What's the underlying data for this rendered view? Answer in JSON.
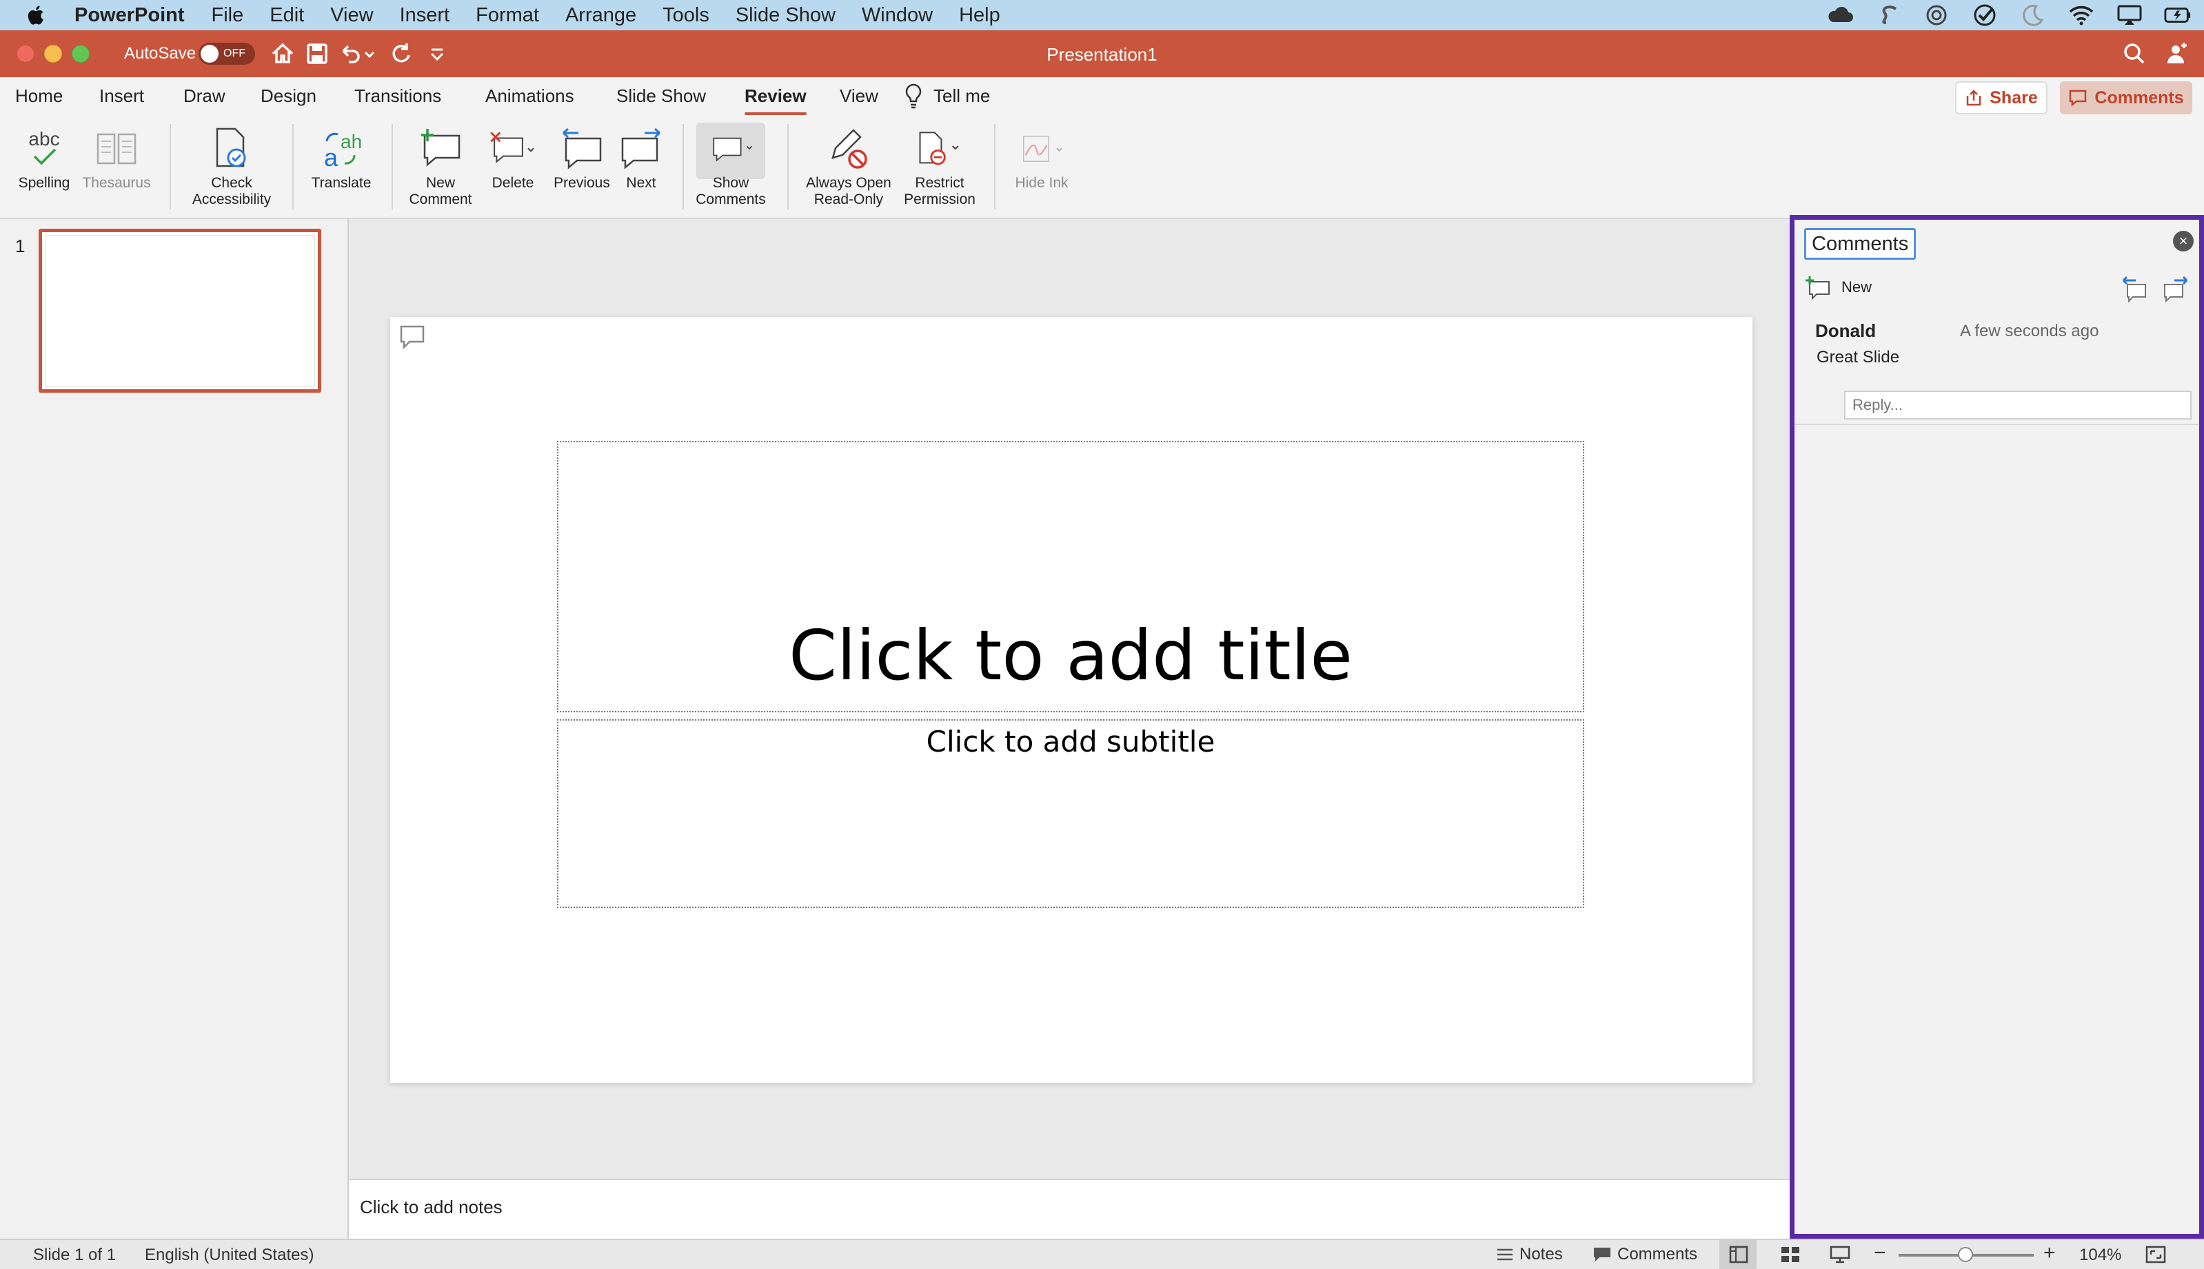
{
  "menubar": {
    "app_name": "PowerPoint",
    "items": [
      "File",
      "Edit",
      "View",
      "Insert",
      "Format",
      "Arrange",
      "Tools",
      "Slide Show",
      "Window",
      "Help"
    ],
    "tray_icons": [
      "cloud-icon",
      "s-app-icon",
      "sync-icon",
      "check-circle-icon",
      "moon-icon",
      "wifi-icon",
      "airplay-icon",
      "battery-icon"
    ]
  },
  "titlebar": {
    "autosave_label": "AutoSave",
    "autosave_state": "OFF",
    "document_title": "Presentation1"
  },
  "tabs": {
    "items": [
      "Home",
      "Insert",
      "Draw",
      "Design",
      "Transitions",
      "Animations",
      "Slide Show",
      "Review",
      "View"
    ],
    "active": "Review",
    "tell_me": "Tell me",
    "share": "Share",
    "comments": "Comments"
  },
  "ribbon": {
    "spelling_label": "Spelling",
    "spelling_glyph": "abc",
    "thesaurus": "Thesaurus",
    "check_accessibility": [
      "Check",
      "Accessibility"
    ],
    "translate": "Translate",
    "new_comment": [
      "New",
      "Comment"
    ],
    "delete": "Delete",
    "previous": "Previous",
    "next": "Next",
    "show_comments": [
      "Show",
      "Comments"
    ],
    "always_open": [
      "Always Open",
      "Read-Only"
    ],
    "restrict": [
      "Restrict",
      "Permission"
    ],
    "hide_ink": "Hide Ink"
  },
  "thumbnails": {
    "slide_number": "1"
  },
  "slide": {
    "title_placeholder": "Click to add title",
    "subtitle_placeholder": "Click to add subtitle"
  },
  "notes": {
    "placeholder": "Click to add notes"
  },
  "comments_pane": {
    "title": "Comments",
    "new_label": "New",
    "comment": {
      "author": "Donald",
      "time": "A few seconds ago",
      "text": "Great Slide"
    },
    "reply_placeholder": "Reply..."
  },
  "status": {
    "slide_info": "Slide 1 of 1",
    "language": "English (United States)",
    "notes": "Notes",
    "comments": "Comments",
    "zoom": "104%"
  },
  "colors": {
    "accent": "#c8553c",
    "pane_border": "#5a2aa6",
    "menubar": "#b9d9ee"
  }
}
